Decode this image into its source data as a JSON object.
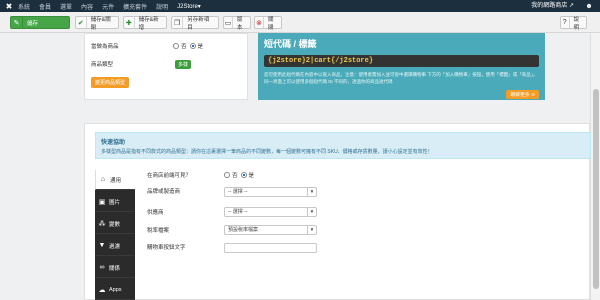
{
  "topbar": {
    "menu": [
      "系統",
      "會員",
      "選單",
      "內容",
      "元件",
      "擴充套件",
      "說明",
      "J2Store▾"
    ],
    "site": "我的網路商店 ↗",
    "user_icon": "user-icon"
  },
  "toolbar": {
    "save": "儲存",
    "save_close": "儲存&關閉",
    "save_new": "儲存&新增",
    "save_copy": "另存新項目",
    "versions": "版本",
    "close": "關閉",
    "help": "說明"
  },
  "left": {
    "shippable_label": "當做為商品",
    "radio_no": "否",
    "radio_yes": "是",
    "product_type_label": "商品類型",
    "product_type_badge": "多樣",
    "change_type_button": "變更商品類型"
  },
  "shortcode": {
    "title": "短代碼 / 標籤",
    "code": "{j2store}2|cart{/j2store}",
    "description": "您可使用此短代碼在內容中以嵌入商品，注意：使用者需加入並可從中選擇購物車 下方的「加入購物車」按鈕，使用「標籤」或「商品」。同一頁面上可以使用多個短代碼 ID 不同的，透過你的商品短代碼",
    "learn_button": "瞭解更多 ⊙"
  },
  "quick": {
    "heading": "快速協助",
    "text": "多樣型商品是指有不同款式的商品類型：請你在這裏選擇一筆商品的不同變數，每一個變數可擁有不同 SKU、價格或存貨數量，請小心設定並有效性！"
  },
  "tabs": [
    {
      "label": "通用",
      "icon": "home-icon"
    },
    {
      "label": "圖片",
      "icon": "image-icon"
    },
    {
      "label": "變數",
      "icon": "sitemap-icon"
    },
    {
      "label": "過濾",
      "icon": "filter-icon"
    },
    {
      "label": "關係",
      "icon": "link-icon"
    },
    {
      "label": "Apps",
      "icon": "apps-icon"
    }
  ],
  "form": {
    "visible_label": "在商店前端可見？",
    "visible_no": "否",
    "visible_yes": "是",
    "brand_label": "品牌或製造商",
    "brand_value": "-- 選擇 --",
    "vendor_label": "供應商",
    "vendor_value": "-- 選擇 --",
    "tax_label": "稅率檔案",
    "tax_value": "預設稅率檔案",
    "cart_text_label": "購物車按鈕文字",
    "cart_text_value": ""
  }
}
